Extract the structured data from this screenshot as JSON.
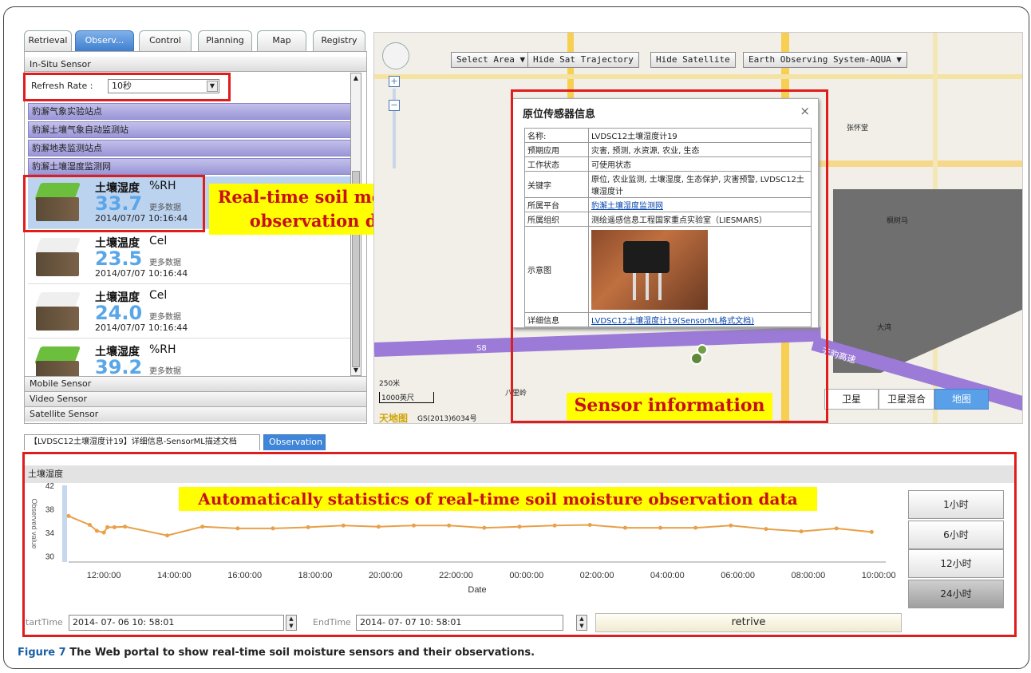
{
  "tabs": [
    "Retrieval",
    "Observ...",
    "Control",
    "Planning",
    "Map",
    "Registry"
  ],
  "sidebar": {
    "insitu_header": "In-Situ Sensor",
    "refresh_label": "Refresh Rate :",
    "refresh_value": "10秒",
    "stations": [
      "豹澥气象实验站点",
      "豹澥土壤气象自动监测站",
      "豹澥地表监测站点",
      "豹澥土壤湿度监测网"
    ],
    "sensors": [
      {
        "name": "土壤湿度",
        "unit": "%RH",
        "value": "33.7",
        "more": "更多数据",
        "time": "2014/07/07 10:16:44"
      },
      {
        "name": "土壤温度",
        "unit": "Cel",
        "value": "23.5",
        "more": "更多数据",
        "time": "2014/07/07 10:16:44"
      },
      {
        "name": "土壤温度",
        "unit": "Cel",
        "value": "24.0",
        "more": "更多数据",
        "time": "2014/07/07 10:16:44"
      },
      {
        "name": "土壤湿度",
        "unit": "%RH",
        "value": "39.2",
        "more": "更多数据",
        "time": ""
      }
    ],
    "bottom_bars": [
      "Mobile Sensor",
      "Video Sensor",
      "Satellite Sensor"
    ]
  },
  "callouts": {
    "realtime": "Real-time soil moisture observation data",
    "sensor_info": "Sensor information",
    "auto_stats": "Automatically statistics of real-time soil moisture observation data"
  },
  "map": {
    "select_area": "Select Area ▼",
    "hide_trajectory": "Hide Sat Trajectory",
    "hide_satellite": "Hide Satellite",
    "satellite_select": "Earth Observing System-AQUA ▼",
    "scale_m": "250米",
    "scale_ft": "1000英尺",
    "copyright": "GS(2013)6034号",
    "brand": "天地图",
    "map_types": [
      "卫星",
      "卫星混合",
      "地图"
    ],
    "labels": {
      "l1": "张怀堂",
      "l2": "枫树马",
      "l3": "大湾",
      "l4": "八里岭",
      "l5": "天豹高速",
      "l6": "S8"
    }
  },
  "popup": {
    "title": "原位传感器信息",
    "close": "×",
    "rows": [
      {
        "k": "名称:",
        "v": "LVDSC12土壤湿度计19"
      },
      {
        "k": "预期应用",
        "v": "灾害, 预测, 水资源, 农业, 生态"
      },
      {
        "k": "工作状态",
        "v": "可使用状态"
      },
      {
        "k": "关键字",
        "v": "原位, 农业监测, 土壤湿度, 生态保护, 灾害预警, LVDSC12土壤湿度计"
      },
      {
        "k": "所属平台",
        "v": "豹澥土壤湿度监测网"
      },
      {
        "k": "所属组织",
        "v": "测绘遥感信息工程国家重点实验室（LIESMARS）"
      },
      {
        "k": "示意图",
        "v": ""
      },
      {
        "k": "详细信息",
        "v": "LVDSC12土壤湿度计19(SensorML格式文档)"
      }
    ]
  },
  "lower_tabs": [
    "【LVDSC12土壤湿度计19】详细信息-SensorML描述文档",
    "Observation"
  ],
  "chart_header": "土壤湿度",
  "range_buttons": [
    "1小时",
    "6小时",
    "12小时",
    "24小时"
  ],
  "time_controls": {
    "start_label": "tartTime",
    "start_value": "2014- 07- 06  10: 58:01",
    "end_label": "EndTime",
    "end_value": "2014- 07- 07  10: 58:01",
    "retrive": "retrive"
  },
  "caption": {
    "label": "Figure 7",
    "text": " The Web portal to show real-time soil moisture sensors and their observations."
  },
  "chart_data": {
    "type": "line",
    "xlabel": "Date",
    "ylabel": "Observed value",
    "ylim": [
      29,
      42
    ],
    "yticks": [
      30,
      34,
      38,
      42
    ],
    "xticks": [
      "12:00:00",
      "14:00:00",
      "16:00:00",
      "18:00:00",
      "20:00:00",
      "22:00:00",
      "00:00:00",
      "02:00:00",
      "04:00:00",
      "06:00:00",
      "08:00:00",
      "10:00:00"
    ],
    "x_hours": [
      11.0,
      11.6,
      11.8,
      12.0,
      12.1,
      12.3,
      12.6,
      13.8,
      14.8,
      15.8,
      16.8,
      17.8,
      18.8,
      19.8,
      20.8,
      21.8,
      22.8,
      23.8,
      24.8,
      25.8,
      26.8,
      27.8,
      28.8,
      29.8,
      30.8,
      31.8,
      32.8,
      33.8
    ],
    "values": [
      36.8,
      35.3,
      34.3,
      34.0,
      34.9,
      34.9,
      35.0,
      33.5,
      35.0,
      34.7,
      34.7,
      34.9,
      35.2,
      35.0,
      35.2,
      35.2,
      34.8,
      35.0,
      35.2,
      35.3,
      34.8,
      34.8,
      34.8,
      35.2,
      34.6,
      34.2,
      34.7,
      34.1,
      33.5
    ],
    "line_color": "#e8a04a"
  }
}
